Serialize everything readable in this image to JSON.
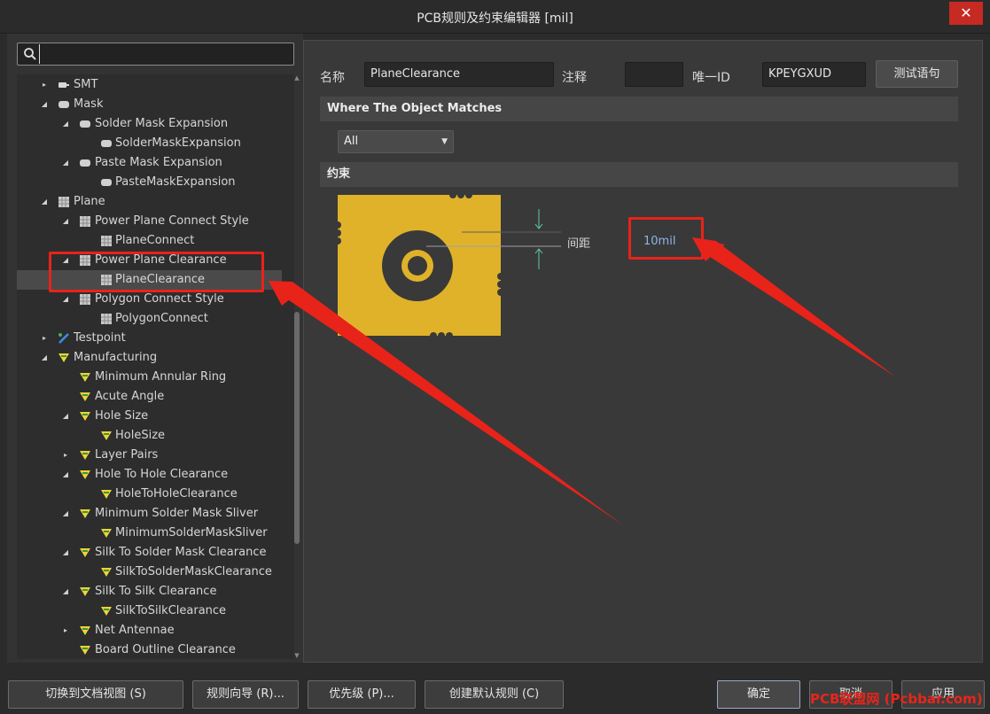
{
  "window": {
    "title": "PCB规则及约束编辑器 [mil]",
    "close_glyph": "✕"
  },
  "search": {
    "value": "",
    "placeholder": ""
  },
  "tree": {
    "items": [
      {
        "label": "SMT",
        "indent": 0,
        "arrow": "▸",
        "icon": "smt-icon",
        "selected": false
      },
      {
        "label": "Mask",
        "indent": 0,
        "arrow": "◢",
        "icon": "mask-icon",
        "selected": false
      },
      {
        "label": "Solder Mask Expansion",
        "indent": 1,
        "arrow": "◢",
        "icon": "mask-icon",
        "selected": false
      },
      {
        "label": "SolderMaskExpansion",
        "indent": 2,
        "arrow": "",
        "icon": "mask-icon",
        "selected": false
      },
      {
        "label": "Paste Mask Expansion",
        "indent": 1,
        "arrow": "◢",
        "icon": "mask-icon",
        "selected": false
      },
      {
        "label": "PasteMaskExpansion",
        "indent": 2,
        "arrow": "",
        "icon": "mask-icon",
        "selected": false
      },
      {
        "label": "Plane",
        "indent": 0,
        "arrow": "◢",
        "icon": "plane-icon",
        "selected": false
      },
      {
        "label": "Power Plane Connect Style",
        "indent": 1,
        "arrow": "◢",
        "icon": "plane-icon",
        "selected": false
      },
      {
        "label": "PlaneConnect",
        "indent": 2,
        "arrow": "",
        "icon": "plane-icon",
        "selected": false
      },
      {
        "label": "Power Plane Clearance",
        "indent": 1,
        "arrow": "◢",
        "icon": "plane-icon",
        "selected": false
      },
      {
        "label": "PlaneClearance",
        "indent": 2,
        "arrow": "",
        "icon": "plane-icon",
        "selected": true
      },
      {
        "label": "Polygon Connect Style",
        "indent": 1,
        "arrow": "◢",
        "icon": "plane-icon",
        "selected": false
      },
      {
        "label": "PolygonConnect",
        "indent": 2,
        "arrow": "",
        "icon": "plane-icon",
        "selected": false
      },
      {
        "label": "Testpoint",
        "indent": 0,
        "arrow": "▸",
        "icon": "testpoint-icon",
        "selected": false
      },
      {
        "label": "Manufacturing",
        "indent": 0,
        "arrow": "◢",
        "icon": "manufacturing-icon",
        "selected": false
      },
      {
        "label": "Minimum Annular Ring",
        "indent": 1,
        "arrow": "",
        "icon": "manufacturing-icon",
        "selected": false
      },
      {
        "label": "Acute Angle",
        "indent": 1,
        "arrow": "",
        "icon": "manufacturing-icon",
        "selected": false
      },
      {
        "label": "Hole Size",
        "indent": 1,
        "arrow": "◢",
        "icon": "manufacturing-icon",
        "selected": false
      },
      {
        "label": "HoleSize",
        "indent": 2,
        "arrow": "",
        "icon": "manufacturing-icon",
        "selected": false
      },
      {
        "label": "Layer Pairs",
        "indent": 1,
        "arrow": "▸",
        "icon": "manufacturing-icon",
        "selected": false
      },
      {
        "label": "Hole To Hole Clearance",
        "indent": 1,
        "arrow": "◢",
        "icon": "manufacturing-icon",
        "selected": false
      },
      {
        "label": "HoleToHoleClearance",
        "indent": 2,
        "arrow": "",
        "icon": "manufacturing-icon",
        "selected": false
      },
      {
        "label": "Minimum Solder Mask Sliver",
        "indent": 1,
        "arrow": "◢",
        "icon": "manufacturing-icon",
        "selected": false
      },
      {
        "label": "MinimumSolderMaskSliver",
        "indent": 2,
        "arrow": "",
        "icon": "manufacturing-icon",
        "selected": false
      },
      {
        "label": "Silk To Solder Mask Clearance",
        "indent": 1,
        "arrow": "◢",
        "icon": "manufacturing-icon",
        "selected": false
      },
      {
        "label": "SilkToSolderMaskClearance",
        "indent": 2,
        "arrow": "",
        "icon": "manufacturing-icon",
        "selected": false
      },
      {
        "label": "Silk To Silk Clearance",
        "indent": 1,
        "arrow": "◢",
        "icon": "manufacturing-icon",
        "selected": false
      },
      {
        "label": "SilkToSilkClearance",
        "indent": 2,
        "arrow": "",
        "icon": "manufacturing-icon",
        "selected": false
      },
      {
        "label": "Net Antennae",
        "indent": 1,
        "arrow": "▸",
        "icon": "manufacturing-icon",
        "selected": false
      },
      {
        "label": "Board Outline Clearance",
        "indent": 1,
        "arrow": "",
        "icon": "manufacturing-icon",
        "selected": false
      }
    ]
  },
  "rule": {
    "name_label": "名称",
    "name_value": "PlaneClearance",
    "comment_label": "注释",
    "comment_value": "",
    "uid_label": "唯一ID",
    "uid_value": "KPEYGXUD",
    "test_button": "测试语句"
  },
  "where": {
    "header": "Where The Object Matches",
    "scope_value": "All"
  },
  "constraints": {
    "header": "约束",
    "clearance_label": "间距",
    "clearance_value": "10mil"
  },
  "footer": {
    "toggle_view": "切换到文档视图 (S)",
    "rule_wizard": "规则向导 (R)...",
    "priorities": "优先级 (P)...",
    "create_default": "创建默认规则 (C)",
    "ok": "确定",
    "cancel": "取消",
    "apply": "应用"
  },
  "watermark": "PCB联盟网 (Pcbbar.com)",
  "colors": {
    "annotation": "#e8231a",
    "plane_copper": "#e0b22a",
    "clearance_value": "#8fb4e8"
  }
}
